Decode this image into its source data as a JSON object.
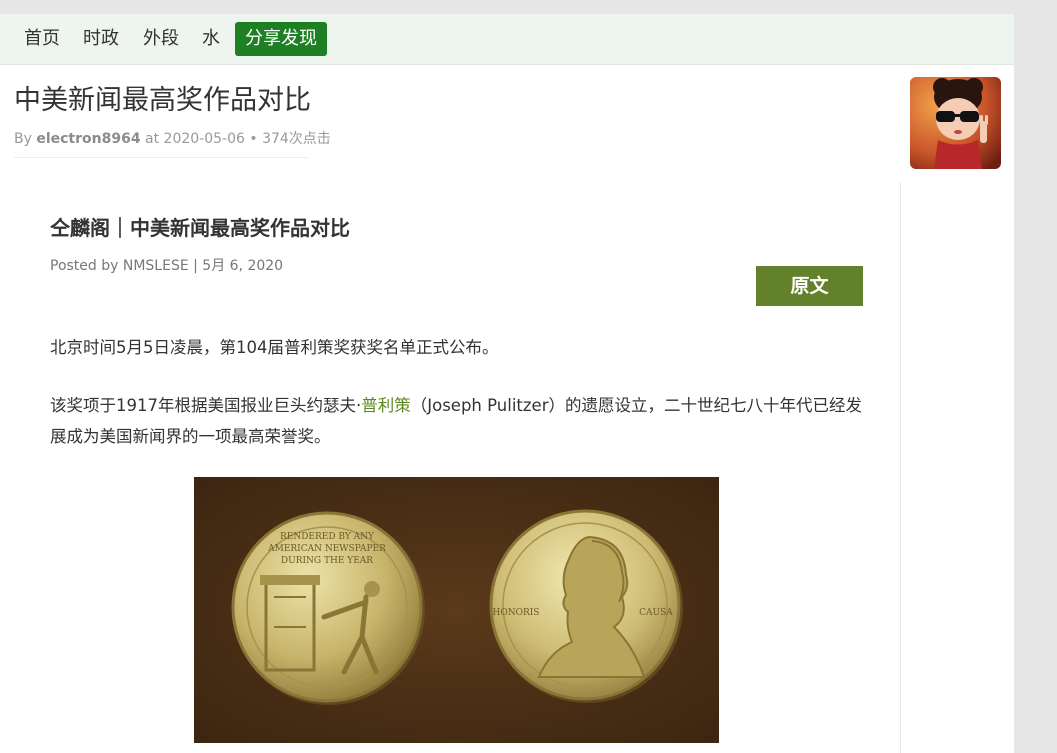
{
  "nav": {
    "items": [
      {
        "label": "首页",
        "active": false
      },
      {
        "label": "时政",
        "active": false
      },
      {
        "label": "外段",
        "active": false
      },
      {
        "label": "水",
        "active": false
      },
      {
        "label": "分享发现",
        "active": true
      }
    ]
  },
  "post": {
    "title": "中美新闻最高奖作品对比",
    "meta_by": "By",
    "author": "electron8964",
    "meta_rest": "at 2020-05-06 • 374次点击"
  },
  "article": {
    "title": "仝麟阁｜中美新闻最高奖作品对比",
    "byline": "Posted by NMSLESE | 5月 6, 2020",
    "source_button": "原文",
    "para1": "北京时间5月5日凌晨，第104届普利策奖获奖名单正式公布。",
    "para2_before": "该奖项于1917年根据美国报业巨头约瑟夫·",
    "para2_link": "普利策",
    "para2_after": "（Joseph Pulitzer）的遗愿设立，二十世纪七八十年代已经发展成为美国新闻界的一项最高荣誉奖。",
    "medal_left_text": "RENDERED BY ANY AMERICAN NEWSPAPER DURING THE YEAR",
    "medal_right_honoris": "HONORIS",
    "medal_right_causa": "CAUSA"
  },
  "colors": {
    "nav_active": "#1e7f25",
    "source_button": "#63802a",
    "link": "#5a8a1e"
  }
}
